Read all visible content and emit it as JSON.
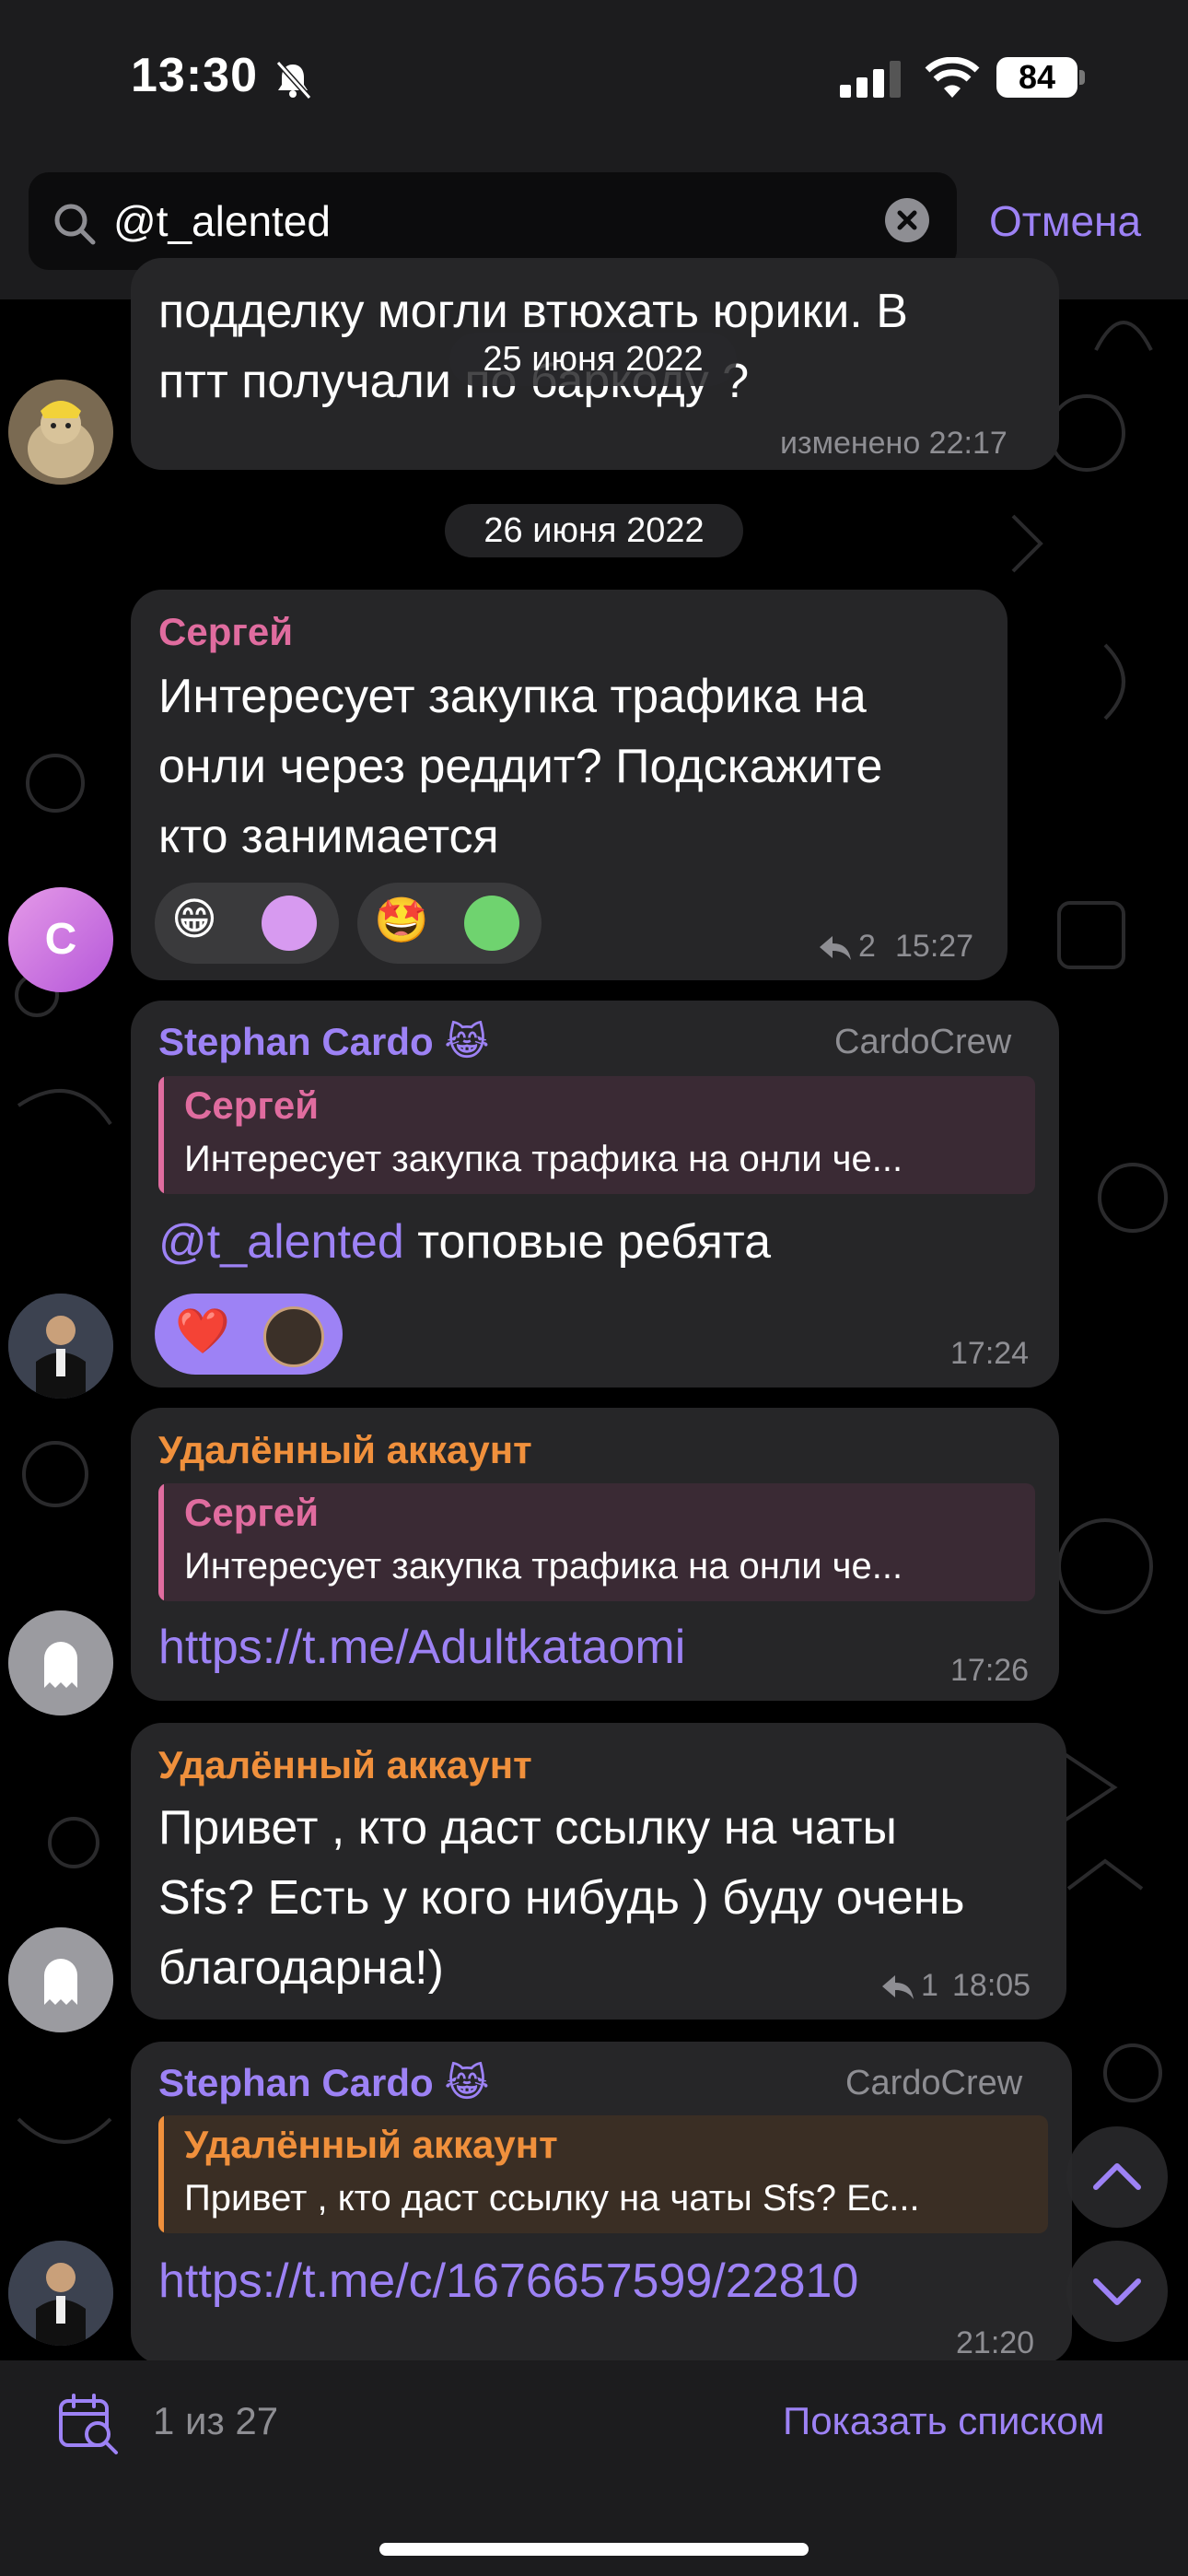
{
  "status_bar": {
    "time": "13:30",
    "battery": "84"
  },
  "search": {
    "query": "@t_alented",
    "cancel_label": "Отмена"
  },
  "messages": [
    {
      "text_line1": "подделку могли втюхать юрики. В",
      "text_line2": "птт получали по баркоду ?",
      "meta": "изменено 22:17"
    },
    {
      "author": "Сергей",
      "text": [
        "Интересует закупка трафика на",
        "онли через реддит? Подскажите",
        "кто занимается"
      ],
      "avatar_letter": "C",
      "replies": "2",
      "time": "15:27"
    },
    {
      "author": "Stephan Cardo 😹",
      "badge": "CardoCrew",
      "quote_author": "Сергей",
      "quote_text": "Интересует закупка трафика на онли че...",
      "mention": "@t_alented",
      "text": " топовые ребята",
      "time": "17:24"
    },
    {
      "author": "Удалённый аккаунт",
      "quote_author": "Сергей",
      "quote_text": "Интересует закупка трафика на онли че...",
      "link": "https://t.me/Adultkataomi",
      "time": "17:26"
    },
    {
      "author": "Удалённый аккаунт",
      "text": [
        "Привет , кто даст ссылку на чаты",
        "Sfs? Есть у кого нибудь ) буду очень",
        "благодарна!)"
      ],
      "replies": "1",
      "time": "18:05"
    },
    {
      "author": "Stephan Cardo 😹",
      "badge": "CardoCrew",
      "quote_author": "Удалённый аккаунт",
      "quote_text": "Привет , кто даст ссылку на чаты Sfs? Ес...",
      "link": "https://t.me/c/1676657599/22810",
      "time": "21:20"
    }
  ],
  "dates": [
    "25 июня 2022",
    "26 июня 2022"
  ],
  "bottom_bar": {
    "counter": "1 из 27",
    "show_list_label": "Показать списком"
  },
  "colors": {
    "accent": "#9d82f5",
    "sergey": "#e06c9f",
    "deleted": "#f0903c",
    "bubble": "#262628"
  }
}
